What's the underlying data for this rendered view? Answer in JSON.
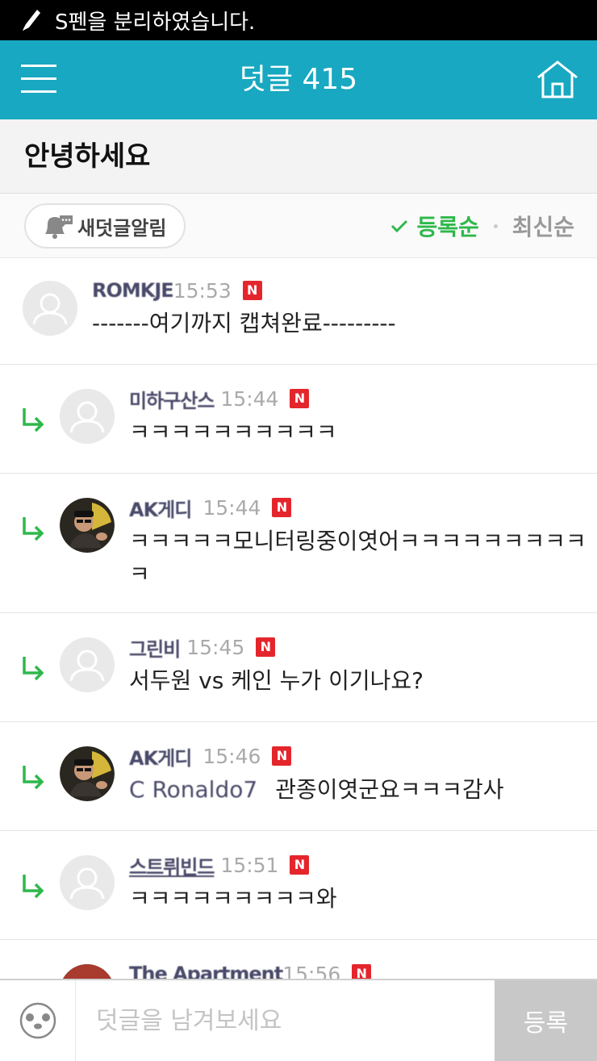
{
  "status_bar": {
    "message": "S펜을 분리하였습니다."
  },
  "header": {
    "title": "덧글 415"
  },
  "post": {
    "title": "안녕하세요"
  },
  "controls": {
    "notify_label": "새덧글알림",
    "sort_options": [
      {
        "label": "등록순",
        "active": true
      },
      {
        "label": "최신순",
        "active": false
      }
    ]
  },
  "comments": [
    {
      "author": "ROMKJE",
      "time": "15:53",
      "new_badge": "N",
      "text": "-------여기까지 캡쳐완료---------",
      "is_reply": false,
      "avatar": "default"
    },
    {
      "author": "미하구산스",
      "time": "15:44",
      "new_badge": "N",
      "text": "ㅋㅋㅋㅋㅋㅋㅋㅋㅋㅋ",
      "is_reply": true,
      "avatar": "default"
    },
    {
      "author": "AK게디",
      "time": "15:44",
      "new_badge": "N",
      "text": "ㅋㅋㅋㅋㅋ모니터링중이엿어ㅋㅋㅋㅋㅋㅋㅋㅋㅋ",
      "text2": "ㅋ",
      "is_reply": true,
      "avatar": "photo"
    },
    {
      "author": "그린비",
      "time": "15:45",
      "new_badge": "N",
      "text": "서두원 vs 케인 누가 이기나요?",
      "is_reply": true,
      "avatar": "default"
    },
    {
      "author": "AK게디",
      "time": "15:46",
      "new_badge": "N",
      "mention": "C Ronaldo7",
      "text": "관종이엿군요ㅋㅋㅋ감사",
      "is_reply": true,
      "avatar": "photo"
    },
    {
      "author": "스트뤼빈드",
      "time": "15:51",
      "new_badge": "N",
      "text": "ㅋㅋㅋㅋㅋㅋㅋㅋㅋ와",
      "is_reply": true,
      "avatar": "default"
    },
    {
      "author": "The Apartment",
      "time": "15:56",
      "new_badge": "N",
      "text": "",
      "is_reply": true,
      "avatar": "photo2"
    }
  ],
  "input": {
    "placeholder": "덧글을 남겨보세요",
    "value": ""
  },
  "submit_label": "등록",
  "colors": {
    "header_bg": "#18a8c1",
    "accent_green": "#2eb84b",
    "new_badge": "#e4262c"
  }
}
